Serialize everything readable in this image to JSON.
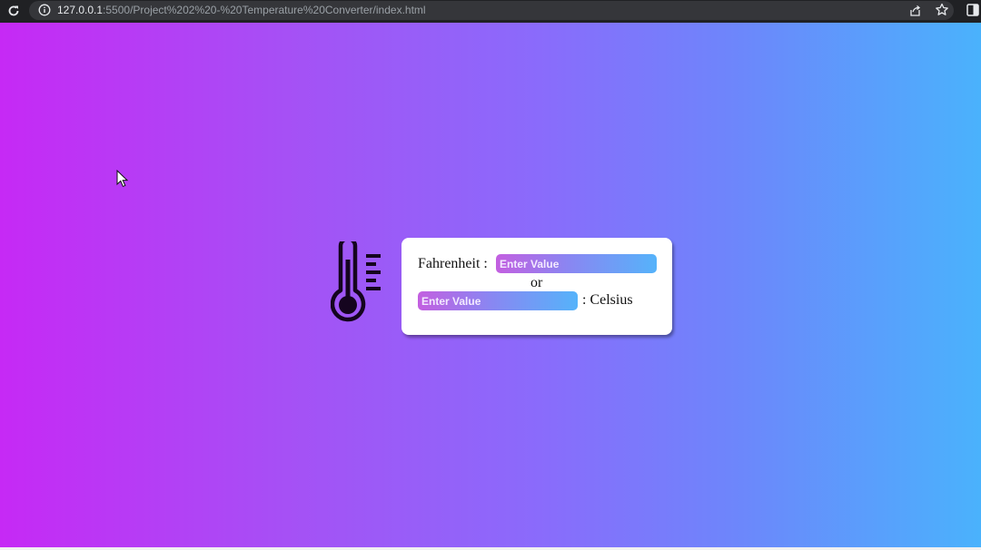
{
  "browser": {
    "url_host": "127.0.0.1",
    "url_rest": ":5500/Project%202%20-%20Temperature%20Converter/index.html"
  },
  "converter": {
    "fahrenheit_label": "Fahrenheit :",
    "fahrenheit_placeholder": "Enter Value",
    "or_label": "or",
    "celsius_placeholder": "Enter Value",
    "celsius_label": ": Celsius"
  },
  "icons": {
    "reload": "reload-icon",
    "info": "info-icon",
    "share": "share-icon",
    "star": "star-icon",
    "side_panel": "side-panel-icon",
    "thermometer": "thermometer-icon",
    "cursor": "mouse-cursor-icon"
  },
  "colors": {
    "gradient_left": "#c629f5",
    "gradient_right": "#4ab2fc",
    "input_gradient_left": "#c35fe0",
    "input_gradient_right": "#55b3fa"
  }
}
